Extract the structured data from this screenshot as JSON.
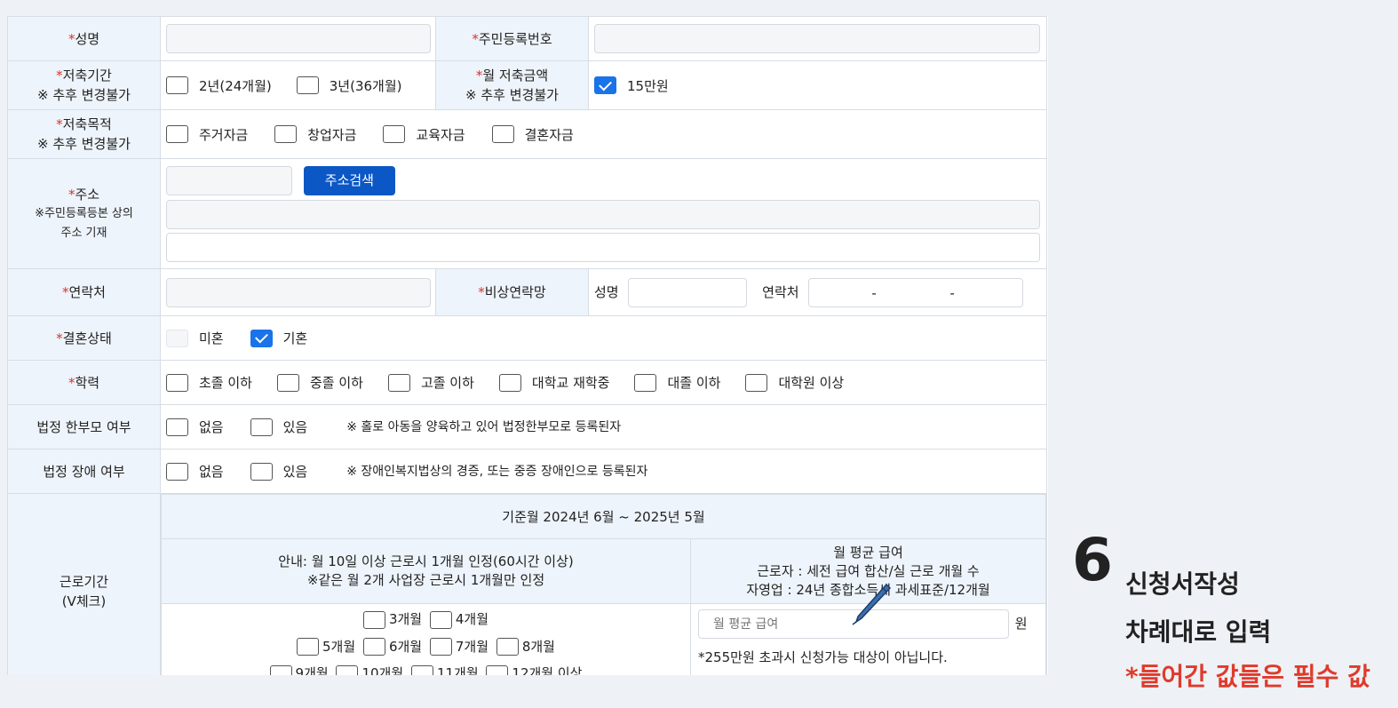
{
  "required_mark": "*",
  "name": {
    "label": "성명"
  },
  "rrn": {
    "label": "주민등록번호"
  },
  "savings_period": {
    "label": "저축기간",
    "note": "※ 추후 변경불가",
    "options": [
      {
        "label": "2년(24개월)",
        "checked": false
      },
      {
        "label": "3년(36개월)",
        "checked": false
      }
    ]
  },
  "monthly_amount": {
    "label": "월 저축금액",
    "note": "※ 추후 변경불가",
    "option": {
      "label": "15만원",
      "checked": true
    }
  },
  "savings_purpose": {
    "label": "저축목적",
    "note": "※ 추후 변경불가",
    "options": [
      {
        "label": "주거자금",
        "checked": false
      },
      {
        "label": "창업자금",
        "checked": false
      },
      {
        "label": "교육자금",
        "checked": false
      },
      {
        "label": "결혼자금",
        "checked": false
      }
    ]
  },
  "address": {
    "label": "주소",
    "note1": "※주민등록등본 상의",
    "note2": "주소 기재",
    "search_button": "주소검색"
  },
  "contact": {
    "label": "연락처"
  },
  "emergency": {
    "label": "비상연락망",
    "name_label": "성명",
    "phone_label": "연락처",
    "sep1": "-",
    "sep2": "-"
  },
  "marital": {
    "label": "결혼상태",
    "options": [
      {
        "label": "미혼",
        "checked": false
      },
      {
        "label": "기혼",
        "checked": true
      }
    ]
  },
  "education": {
    "label": "학력",
    "options": [
      {
        "label": "초졸 이하",
        "checked": false
      },
      {
        "label": "중졸 이하",
        "checked": false
      },
      {
        "label": "고졸 이하",
        "checked": false
      },
      {
        "label": "대학교 재학중",
        "checked": false
      },
      {
        "label": "대졸 이하",
        "checked": false
      },
      {
        "label": "대학원 이상",
        "checked": false
      }
    ]
  },
  "single_parent": {
    "label": "법정 한부모 여부",
    "options": [
      {
        "label": "없음"
      },
      {
        "label": "있음"
      }
    ],
    "hint": "※ 홀로 아동을 양육하고 있어 법정한부모로 등록된자"
  },
  "disability": {
    "label": "법정 장애 여부",
    "options": [
      {
        "label": "없음"
      },
      {
        "label": "있음"
      }
    ],
    "hint": "※ 장애인복지법상의 경증, 또는 중증 장애인으로 등록된자"
  },
  "work_period": {
    "label1": "근로기간",
    "label2": "(V체크)",
    "base_month": "기준월 2024년 6월 ~ 2025년 5월",
    "guide1": "안내: 월 10일 이상 근로시 1개월 인정(60시간 이상)",
    "guide2": "※같은 월 2개 사업장 근로시 1개월만 인정",
    "salary_title": "월 평균 급여",
    "salary_line1": "근로자 : 세전 급여 합산/실 근로 개월 수",
    "salary_line2": "자영업 : 24년 종합소득세 과세표준/12개월",
    "months_row1": [
      "3개월",
      "4개월"
    ],
    "months_row2": [
      "5개월",
      "6개월",
      "7개월",
      "8개월"
    ],
    "months_row3": [
      "9개월",
      "10개월",
      "11개월",
      "12개월 이상"
    ],
    "salary_placeholder": "월 평균 급여",
    "salary_unit": "원",
    "salary_warning": "*255만원 초과시 신청가능 대상이 아닙니다."
  },
  "side": {
    "step_number": "6",
    "title": "신청서작성",
    "subtitle": "차례대로 입력",
    "warning": "*들어간 값들은 필수 값"
  },
  "colors": {
    "accent": "#0b57c5",
    "check": "#1a73e8",
    "required": "#d9342b",
    "warning": "#e03a2b",
    "label_bg": "#eef4fb"
  }
}
